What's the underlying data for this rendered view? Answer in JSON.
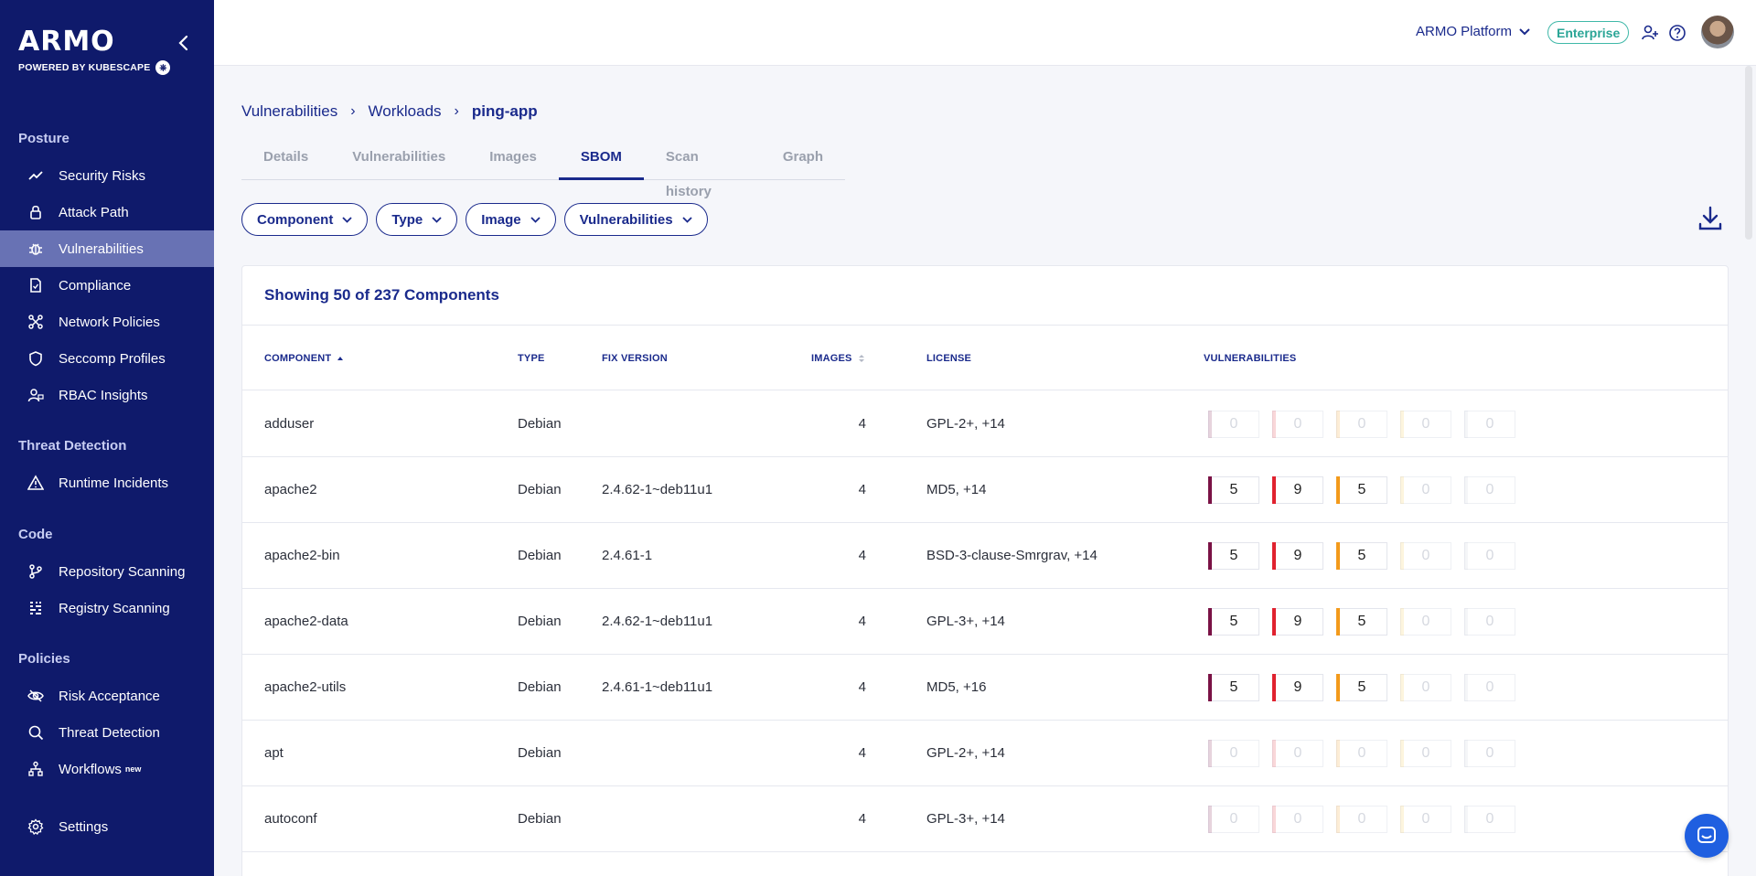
{
  "brand": {
    "logo": "ARMO",
    "sub": "POWERED BY KUBESCAPE"
  },
  "sidebar": {
    "sections": [
      {
        "title": "Posture",
        "items": [
          {
            "label": "Security Risks",
            "icon": "trend-icon"
          },
          {
            "label": "Attack Path",
            "icon": "lock-icon"
          },
          {
            "label": "Vulnerabilities",
            "icon": "bug-icon",
            "active": true
          },
          {
            "label": "Compliance",
            "icon": "document-icon"
          },
          {
            "label": "Network Policies",
            "icon": "network-icon"
          },
          {
            "label": "Seccomp Profiles",
            "icon": "shield-icon"
          },
          {
            "label": "RBAC Insights",
            "icon": "user-lock-icon"
          }
        ]
      },
      {
        "title": "Threat Detection",
        "items": [
          {
            "label": "Runtime Incidents",
            "icon": "warning-icon"
          }
        ]
      },
      {
        "title": "Code",
        "items": [
          {
            "label": "Repository Scanning",
            "icon": "branch-icon"
          },
          {
            "label": "Registry Scanning",
            "icon": "grid-icon"
          }
        ]
      },
      {
        "title": "Policies",
        "items": [
          {
            "label": "Risk Acceptance",
            "icon": "eye-off-icon"
          },
          {
            "label": "Threat Detection",
            "icon": "search-icon"
          },
          {
            "label": "Workflows",
            "icon": "workflow-icon",
            "badge": "new"
          }
        ]
      }
    ],
    "settings": "Settings"
  },
  "topbar": {
    "platform": "ARMO Platform",
    "plan": "Enterprise"
  },
  "breadcrumb": [
    "Vulnerabilities",
    "Workloads",
    "ping-app"
  ],
  "tabs": [
    "Details",
    "Vulnerabilities",
    "Images",
    "SBOM",
    "Scan history",
    "Graph"
  ],
  "active_tab": "SBOM",
  "filters": [
    "Component",
    "Type",
    "Image",
    "Vulnerabilities"
  ],
  "table": {
    "title": "Showing 50 of 237 Components",
    "headers": [
      "COMPONENT",
      "TYPE",
      "FIX VERSION",
      "IMAGES",
      "LICENSE",
      "VULNERABILITIES"
    ],
    "severity_colors": [
      "#7a1245",
      "#e0222f",
      "#f39a1b",
      "#f6c54a",
      "#c7ccd6"
    ],
    "rows": [
      {
        "component": "adduser",
        "type": "Debian",
        "fix": "",
        "images": "4",
        "license": "GPL-2+, +14",
        "vulns": [
          "0",
          "0",
          "0",
          "0",
          "0"
        ]
      },
      {
        "component": "apache2",
        "type": "Debian",
        "fix": "2.4.62-1~deb11u1",
        "images": "4",
        "license": "MD5, +14",
        "vulns": [
          "5",
          "9",
          "5",
          "0",
          "0"
        ]
      },
      {
        "component": "apache2-bin",
        "type": "Debian",
        "fix": "2.4.61-1",
        "images": "4",
        "license": "BSD-3-clause-Smrgrav, +14",
        "vulns": [
          "5",
          "9",
          "5",
          "0",
          "0"
        ]
      },
      {
        "component": "apache2-data",
        "type": "Debian",
        "fix": "2.4.62-1~deb11u1",
        "images": "4",
        "license": "GPL-3+, +14",
        "vulns": [
          "5",
          "9",
          "5",
          "0",
          "0"
        ]
      },
      {
        "component": "apache2-utils",
        "type": "Debian",
        "fix": "2.4.61-1~deb11u1",
        "images": "4",
        "license": "MD5, +16",
        "vulns": [
          "5",
          "9",
          "5",
          "0",
          "0"
        ]
      },
      {
        "component": "apt",
        "type": "Debian",
        "fix": "",
        "images": "4",
        "license": "GPL-2+, +14",
        "vulns": [
          "0",
          "0",
          "0",
          "0",
          "0"
        ]
      },
      {
        "component": "autoconf",
        "type": "Debian",
        "fix": "",
        "images": "4",
        "license": "GPL-3+, +14",
        "vulns": [
          "0",
          "0",
          "0",
          "0",
          "0"
        ]
      }
    ]
  }
}
